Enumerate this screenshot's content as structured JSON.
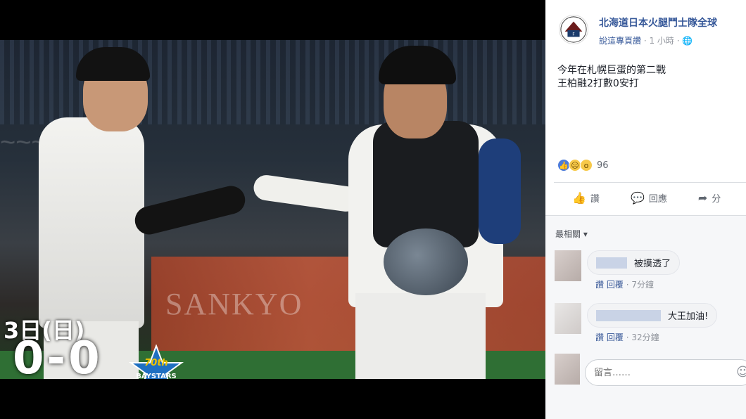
{
  "photo": {
    "score_date": "3日(日)",
    "score_result": "0-0",
    "team_logo_text": "BAYSTARS",
    "team_logo_badge": "70th",
    "banner_text": "SANKYO"
  },
  "post": {
    "page_name": "北海道日本火腿鬥士隊全球",
    "recommend_label": "說這專頁讚",
    "time_label": "· 1 小時 ·",
    "globe_icon": "globe-icon",
    "lines": [
      "今年在札幌巨蛋的第二戰",
      "王柏融2打數0安打"
    ],
    "reaction_count": "96",
    "reaction_icons": [
      "like-icon",
      "sad-icon",
      "wow-icon"
    ]
  },
  "actions": [
    {
      "label": "讚",
      "icon": "thumbs-up-icon"
    },
    {
      "label": "回應",
      "icon": "comment-icon"
    },
    {
      "label": "分",
      "icon": "share-icon"
    }
  ],
  "comments_section": {
    "sort_label": "最相關 ▾",
    "comments": [
      {
        "text": "被摸透了",
        "like": "讚",
        "reply": "回覆",
        "time": "· 7分鐘"
      },
      {
        "text": "大王加油!",
        "like": "讚",
        "reply": "回覆",
        "time": "· 32分鐘"
      }
    ],
    "reply_placeholder": "留言……",
    "emoji_icon": "smile-icon"
  },
  "colors": {
    "link_blue": "#365899",
    "panel_bg": "#f6f7f9",
    "like_blue": "#4c7bd9"
  }
}
